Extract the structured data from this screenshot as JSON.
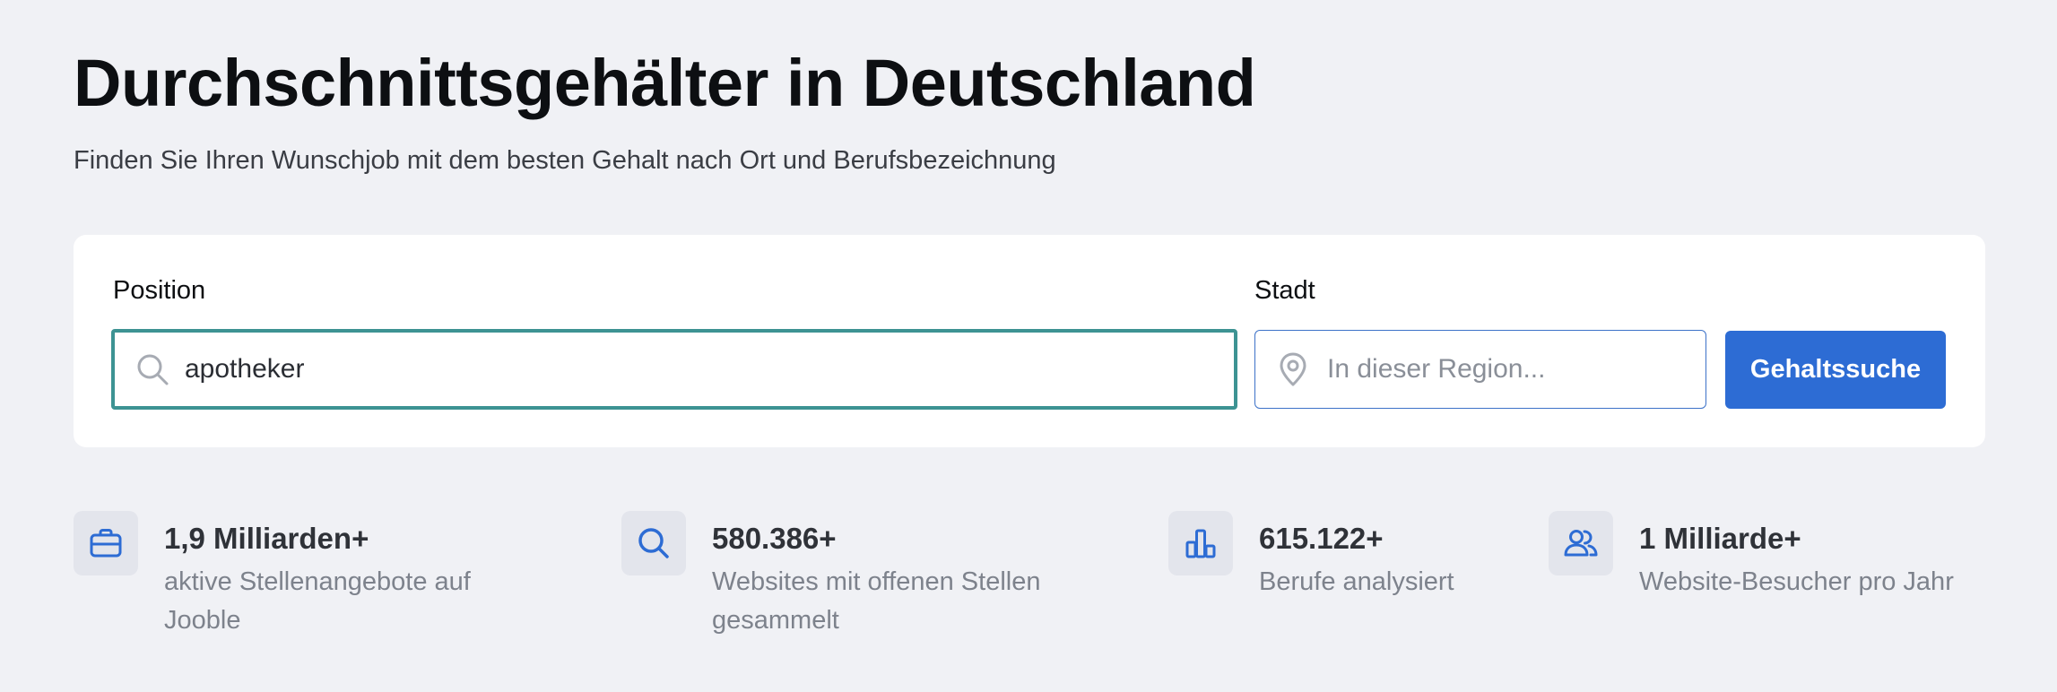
{
  "header": {
    "title": "Durchschnittsgehälter in Deutschland",
    "subtitle": "Finden Sie Ihren Wunschjob mit dem besten Gehalt nach Ort und Berufsbezeichnung"
  },
  "search": {
    "position_label": "Position",
    "position_value": "apotheker",
    "city_label": "Stadt",
    "city_placeholder": "In dieser Region...",
    "button_label": "Gehaltssuche"
  },
  "stats": [
    {
      "icon": "briefcase-icon",
      "number": "1,9 Milliarden+",
      "description": "aktive Stellenangebote auf Jooble"
    },
    {
      "icon": "search-icon",
      "number": "580.386+",
      "description": "Websites mit offenen Stellen gesammelt"
    },
    {
      "icon": "bar-chart-icon",
      "number": "615.122+",
      "description": "Berufe analysiert"
    },
    {
      "icon": "users-icon",
      "number": "1 Milliarde+",
      "description": "Website-Besucher pro Jahr"
    }
  ],
  "colors": {
    "accent": "#2d6cd4",
    "focus_border": "#3d9393",
    "background": "#f0f1f5"
  }
}
